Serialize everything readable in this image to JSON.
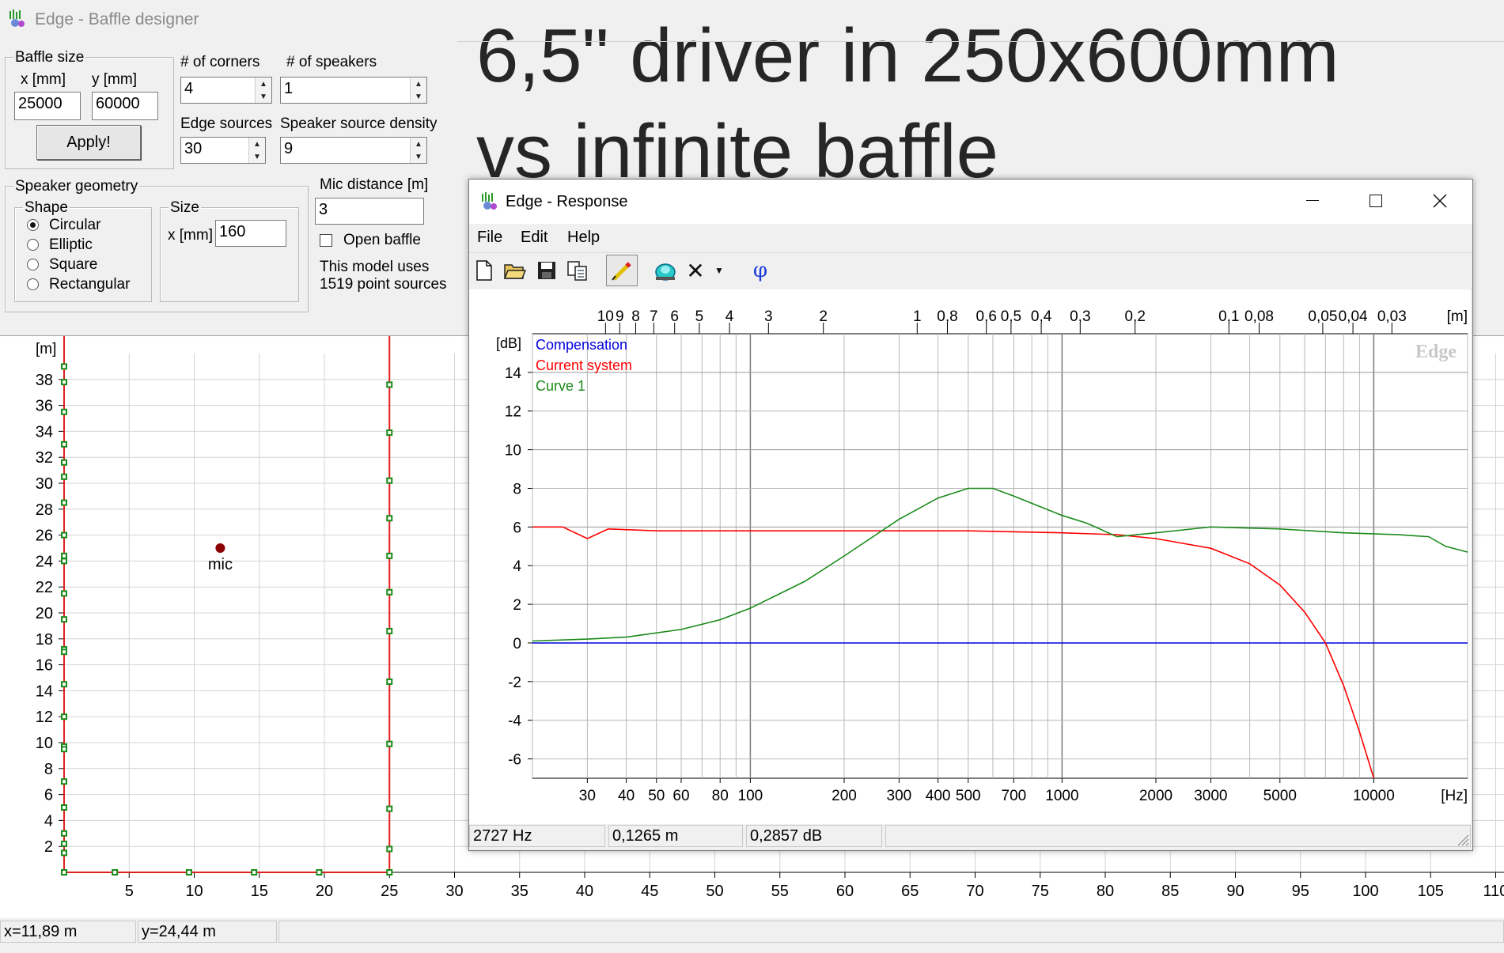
{
  "main_window": {
    "title": "Edge - Baffle designer",
    "overlay_heading_line1": "6,5\" driver in 250x600mm",
    "overlay_heading_line2": "vs infinite baffle",
    "baffle_size": {
      "legend": "Baffle size",
      "x_label": "x [mm]",
      "y_label": "y [mm]",
      "x_value": "25000",
      "y_value": "60000",
      "apply_label": "Apply!"
    },
    "corners": {
      "label": "# of corners",
      "value": "4"
    },
    "speakers": {
      "label": "# of speakers",
      "value": "1"
    },
    "edge_sources": {
      "label": "Edge sources",
      "value": "30"
    },
    "speaker_density": {
      "label": "Speaker source density",
      "value": "9"
    },
    "speaker_geometry": {
      "legend": "Speaker geometry",
      "shape_legend": "Shape",
      "shapes": [
        "Circular",
        "Elliptic",
        "Square",
        "Rectangular"
      ],
      "selected_shape": "Circular",
      "size_legend": "Size",
      "size_x_label": "x [mm]",
      "size_x_value": "160"
    },
    "mic_distance": {
      "label": "Mic distance [m]",
      "value": "3"
    },
    "open_baffle": {
      "label": "Open baffle",
      "checked": false
    },
    "model_info_line1": "This model uses",
    "model_info_line2": "1519 point sources",
    "plot": {
      "y_unit": "[m]",
      "y_ticks": [
        "2",
        "4",
        "6",
        "8",
        "10",
        "12",
        "14",
        "16",
        "18",
        "20",
        "22",
        "24",
        "26",
        "28",
        "30",
        "32",
        "34",
        "36",
        "38"
      ],
      "x_ticks": [
        "5",
        "10",
        "15",
        "20",
        "25",
        "30",
        "35",
        "40",
        "45",
        "50",
        "55",
        "60",
        "65",
        "70",
        "75",
        "80",
        "85",
        "90",
        "95",
        "100",
        "105",
        "110"
      ],
      "mic_label": "mic",
      "mic_position": {
        "x": 12,
        "y": 25
      },
      "baffle_outline": {
        "width": 25,
        "height": 60
      },
      "edge_color": "#e02020",
      "source_color": "#1a8a1a",
      "mic_color": "#8b0000"
    },
    "status": {
      "x": "x=11,89 m",
      "y": "y=24,44 m"
    }
  },
  "response_window": {
    "title": "Edge - Response",
    "menu": [
      "File",
      "Edit",
      "Help"
    ],
    "toolbar_icons": [
      "new-file-icon",
      "open-folder-icon",
      "save-disk-icon",
      "copy-icon",
      "pencil-draw-icon",
      "speaker-icon",
      "delete-x-icon",
      "dropdown-arrow-icon",
      "phase-phi-icon"
    ],
    "phase_symbol": "φ",
    "delete_symbol": "✕",
    "watermark": "Edge",
    "status": {
      "freq": "2727 Hz",
      "distance": "0,1265 m",
      "level": "0,2857 dB"
    },
    "axis": {
      "y_unit": "[dB]",
      "x_unit": "[Hz]",
      "top_unit": "[m]",
      "y_tick_labels": [
        "-6",
        "-4",
        "-2",
        "0",
        "2",
        "4",
        "6",
        "8",
        "10",
        "12",
        "14"
      ],
      "x_tick_labels": [
        "30",
        "40",
        "50",
        "60",
        "80",
        "100",
        "200",
        "300",
        "400",
        "500",
        "700",
        "1000",
        "2000",
        "3000",
        "5000",
        "10000"
      ],
      "top_tick_labels": [
        "10",
        "9",
        "8",
        "7",
        "6",
        "5",
        "4",
        "3",
        "2",
        "1",
        "0,8",
        "0,6",
        "0,5",
        "0,4",
        "0,3",
        "0,2",
        "0,1",
        "0,08",
        "0,05",
        "0,04",
        "0,03"
      ]
    }
  },
  "chart_data": {
    "type": "line",
    "title": "",
    "xlabel": "[Hz]",
    "ylabel": "[dB]",
    "x_scale": "log",
    "xlim": [
      20,
      20000
    ],
    "ylim": [
      -7,
      16
    ],
    "grid": true,
    "legend_position": "top-left",
    "series": [
      {
        "name": "Compensation",
        "color": "#0000e0",
        "x": [
          20,
          20000
        ],
        "y": [
          0,
          0
        ]
      },
      {
        "name": "Current system",
        "color": "#ff0000",
        "x": [
          20,
          25,
          30,
          35,
          50,
          100,
          200,
          500,
          1000,
          1500,
          2000,
          3000,
          4000,
          5000,
          6000,
          7000,
          8000,
          9000,
          10000
        ],
        "y": [
          6.0,
          6.0,
          5.4,
          5.9,
          5.8,
          5.8,
          5.8,
          5.8,
          5.7,
          5.6,
          5.4,
          4.9,
          4.1,
          3.0,
          1.6,
          0.0,
          -2.2,
          -4.6,
          -7.0
        ]
      },
      {
        "name": "Curve 1",
        "color": "#1a8a1a",
        "x": [
          20,
          30,
          40,
          60,
          80,
          100,
          150,
          200,
          300,
          400,
          500,
          600,
          700,
          1000,
          1200,
          1500,
          2000,
          3000,
          5000,
          8000,
          12000,
          15000,
          17000,
          20000
        ],
        "y": [
          0.1,
          0.2,
          0.3,
          0.7,
          1.2,
          1.8,
          3.2,
          4.5,
          6.4,
          7.5,
          8.0,
          8.0,
          7.6,
          6.6,
          6.2,
          5.5,
          5.7,
          6.0,
          5.9,
          5.7,
          5.6,
          5.5,
          5.0,
          4.7
        ]
      }
    ]
  }
}
